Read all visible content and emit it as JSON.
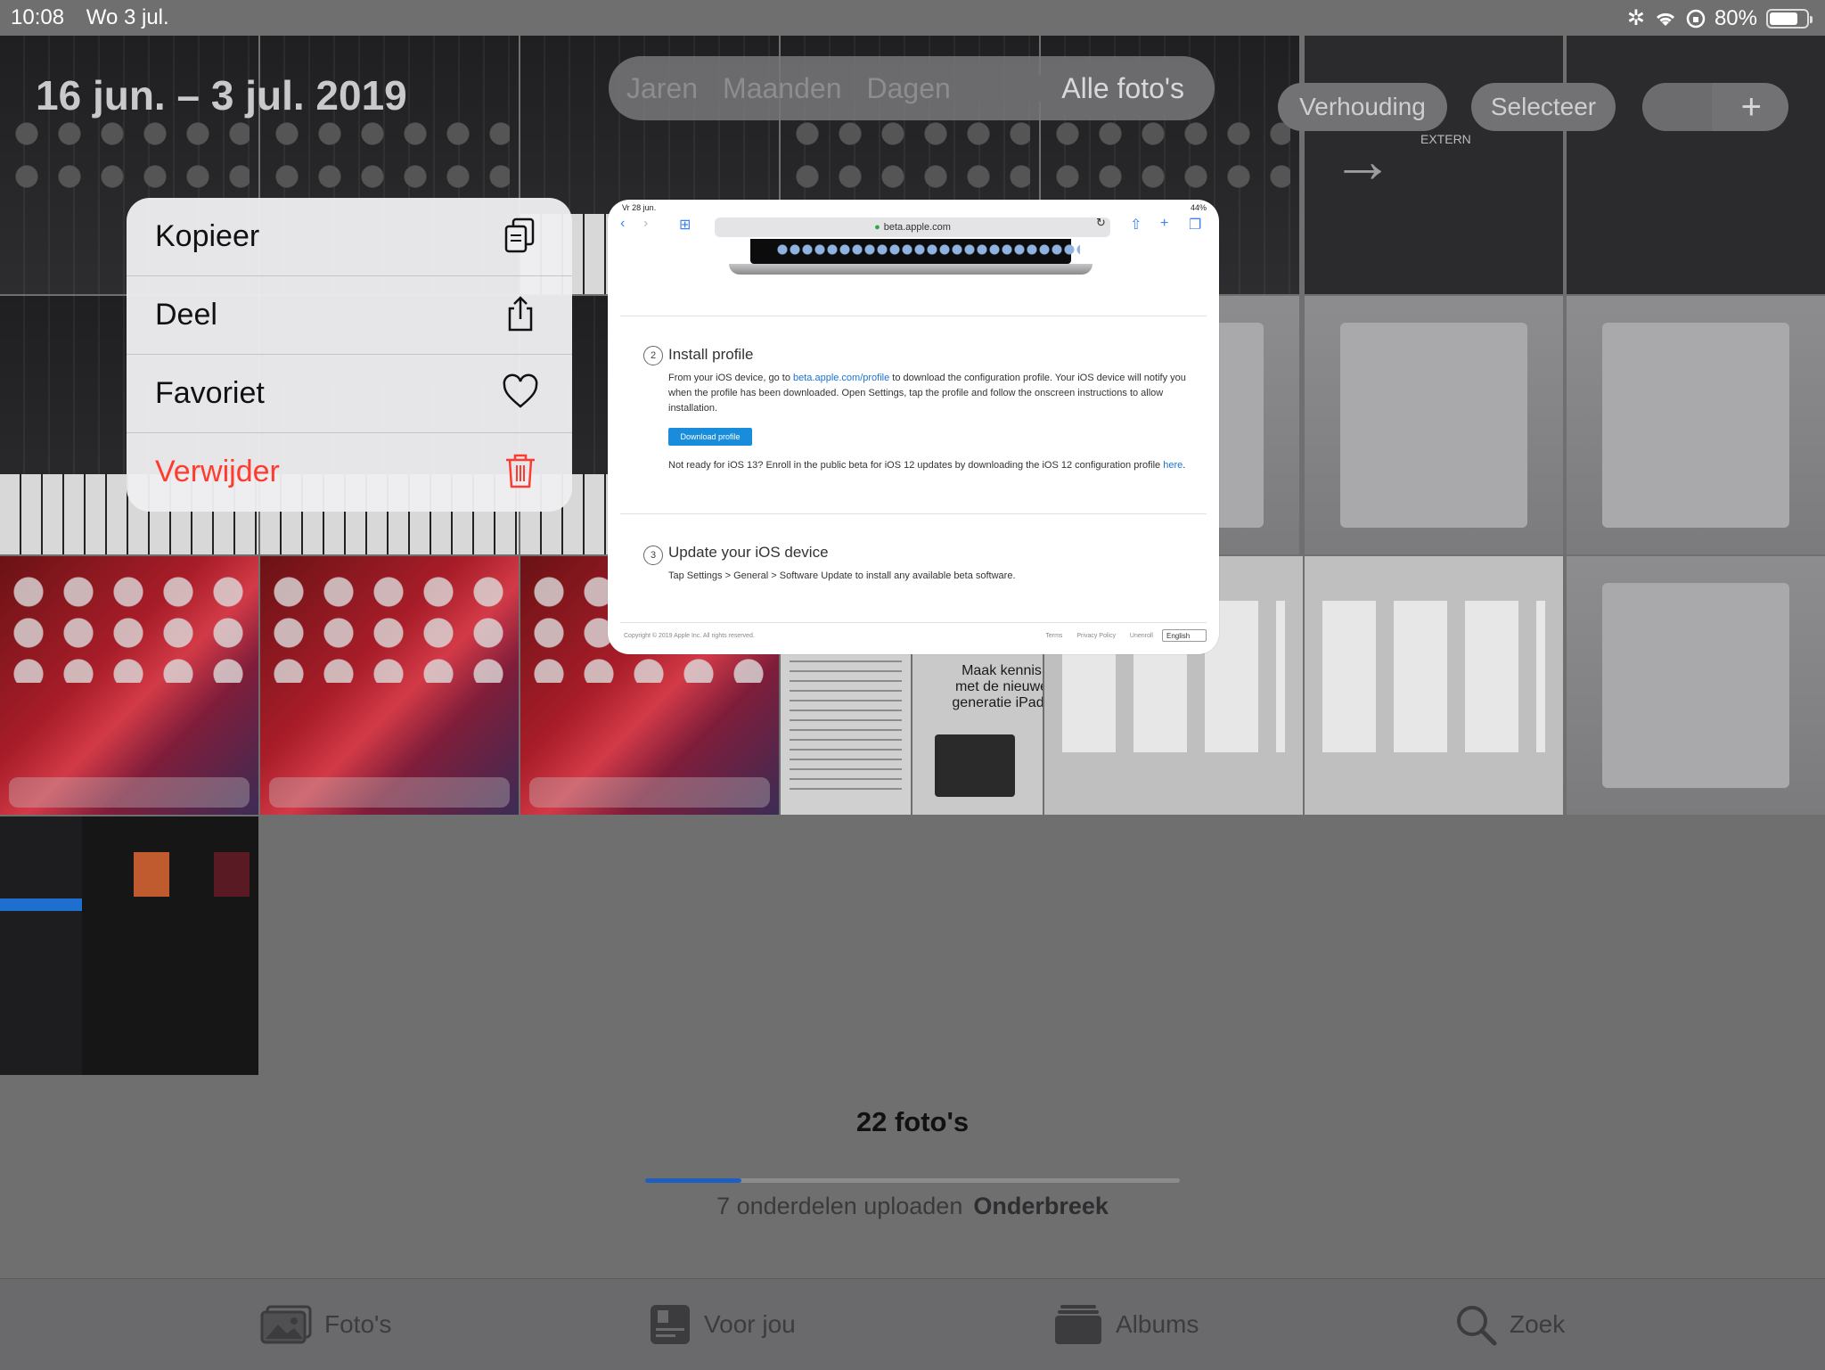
{
  "status_bar": {
    "time": "10:08",
    "date": "Wo 3 jul.",
    "battery": "80%",
    "battery_level": 0.8
  },
  "header": {
    "date_range": "16 jun. – 3 jul. 2019",
    "view_tabs": [
      {
        "label": "Jaren",
        "active": false
      },
      {
        "label": "Maanden",
        "active": false
      },
      {
        "label": "Dagen",
        "active": false
      },
      {
        "label": "Alle foto's",
        "active": true
      }
    ],
    "ratio_button": "Verhouding",
    "select_button": "Selecteer",
    "add_button": "+"
  },
  "context_menu": {
    "items": [
      {
        "label": "Kopieer",
        "icon": "copy-icon",
        "destructive": false
      },
      {
        "label": "Deel",
        "icon": "share-icon",
        "destructive": false
      },
      {
        "label": "Favoriet",
        "icon": "heart-icon",
        "destructive": false
      },
      {
        "label": "Verwijder",
        "icon": "trash-icon",
        "destructive": true
      }
    ]
  },
  "preview": {
    "status_left": "Vr 28 jun.",
    "status_right": "44%",
    "url": "beta.apple.com",
    "laptop_label": "MacBook Pro",
    "step2": {
      "number": "2",
      "title": "Install profile",
      "body_pre": "From your iOS device, go to ",
      "body_link": "beta.apple.com/profile",
      "body_post": " to download the configuration profile. Your iOS device will notify you when the profile has been downloaded. Open Settings, tap the profile and follow the onscreen instructions to allow installation.",
      "button": "Download profile",
      "note_pre": "Not ready for iOS 13? Enroll in the public beta for iOS 12 updates by downloading the iOS 12 configuration profile ",
      "note_link": "here",
      "note_post": "."
    },
    "step3": {
      "number": "3",
      "title": "Update your iOS device",
      "body": "Tap Settings > General > Software Update to install any available beta software."
    },
    "footer": {
      "copyright": "Copyright © 2019 Apple Inc. All rights reserved.",
      "links": [
        "Terms",
        "Privacy Policy",
        "Unenroll"
      ],
      "language": "English"
    }
  },
  "grid_text": {
    "extern": "EXTERN",
    "ad_text": "Maak kennis met de nieuwe generatie iPads"
  },
  "summary": {
    "photo_count": "22 foto's",
    "upload_text": "7 onderdelen uploaden",
    "pause_label": "Onderbreek",
    "progress": 0.18
  },
  "tabbar": {
    "tabs": [
      {
        "label": "Foto's",
        "icon": "photos-icon"
      },
      {
        "label": "Voor jou",
        "icon": "for-you-icon"
      },
      {
        "label": "Albums",
        "icon": "albums-icon"
      },
      {
        "label": "Zoek",
        "icon": "search-icon"
      }
    ]
  },
  "colors": {
    "destructive": "#ff3b30",
    "accent": "#1f5fbf",
    "dim_background": "#6f6f70"
  }
}
